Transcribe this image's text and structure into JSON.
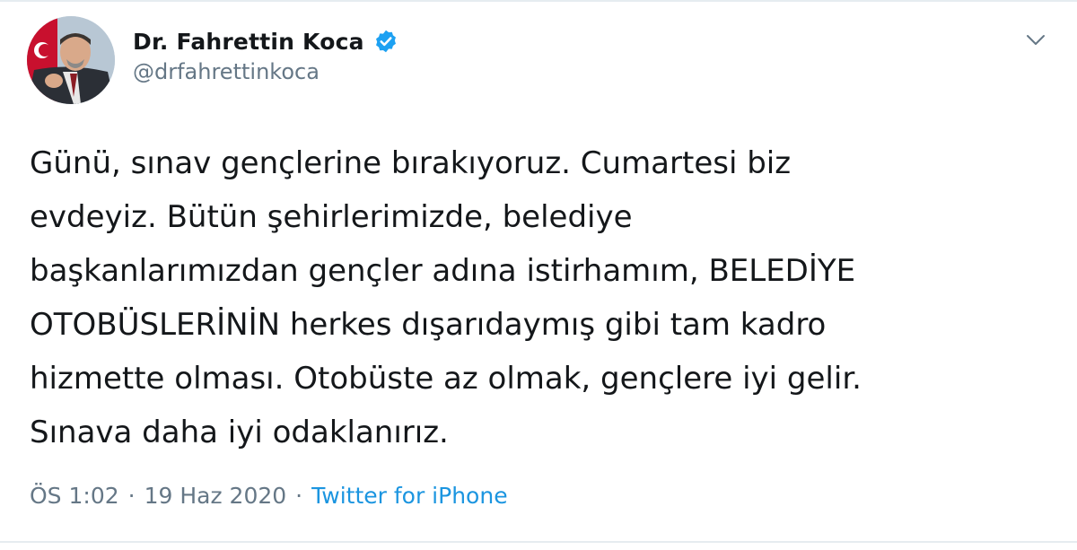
{
  "author": {
    "name": "Dr. Fahrettin Koca",
    "handle": "@drfahrettinkoca",
    "verified": true,
    "avatar_icon": "profile-photo"
  },
  "tweet": {
    "lines": [
      "Günü, sınav gençlerine bırakıyoruz. Cumartesi biz",
      "evdeyiz. Bütün şehirlerimizde, belediye",
      "başkanlarımızdan gençler adına istirhamım, BELEDİYE",
      "OTOBÜSLERİNİN herkes dışarıdaymış gibi tam kadro",
      "hizmette olması. Otobüste az olmak, gençlere iyi gelir.",
      "Sınava daha iyi odaklanırız."
    ],
    "time": "ÖS 1:02",
    "date": "19 Haz 2020",
    "separator": "·",
    "source": "Twitter for iPhone"
  },
  "icons": {
    "verified": "verified-badge-icon",
    "more": "chevron-down-icon"
  },
  "colors": {
    "text": "#14171a",
    "secondary": "#657786",
    "link": "#1b95e0",
    "verified": "#1da1f2",
    "divider": "#e6ecf0"
  }
}
